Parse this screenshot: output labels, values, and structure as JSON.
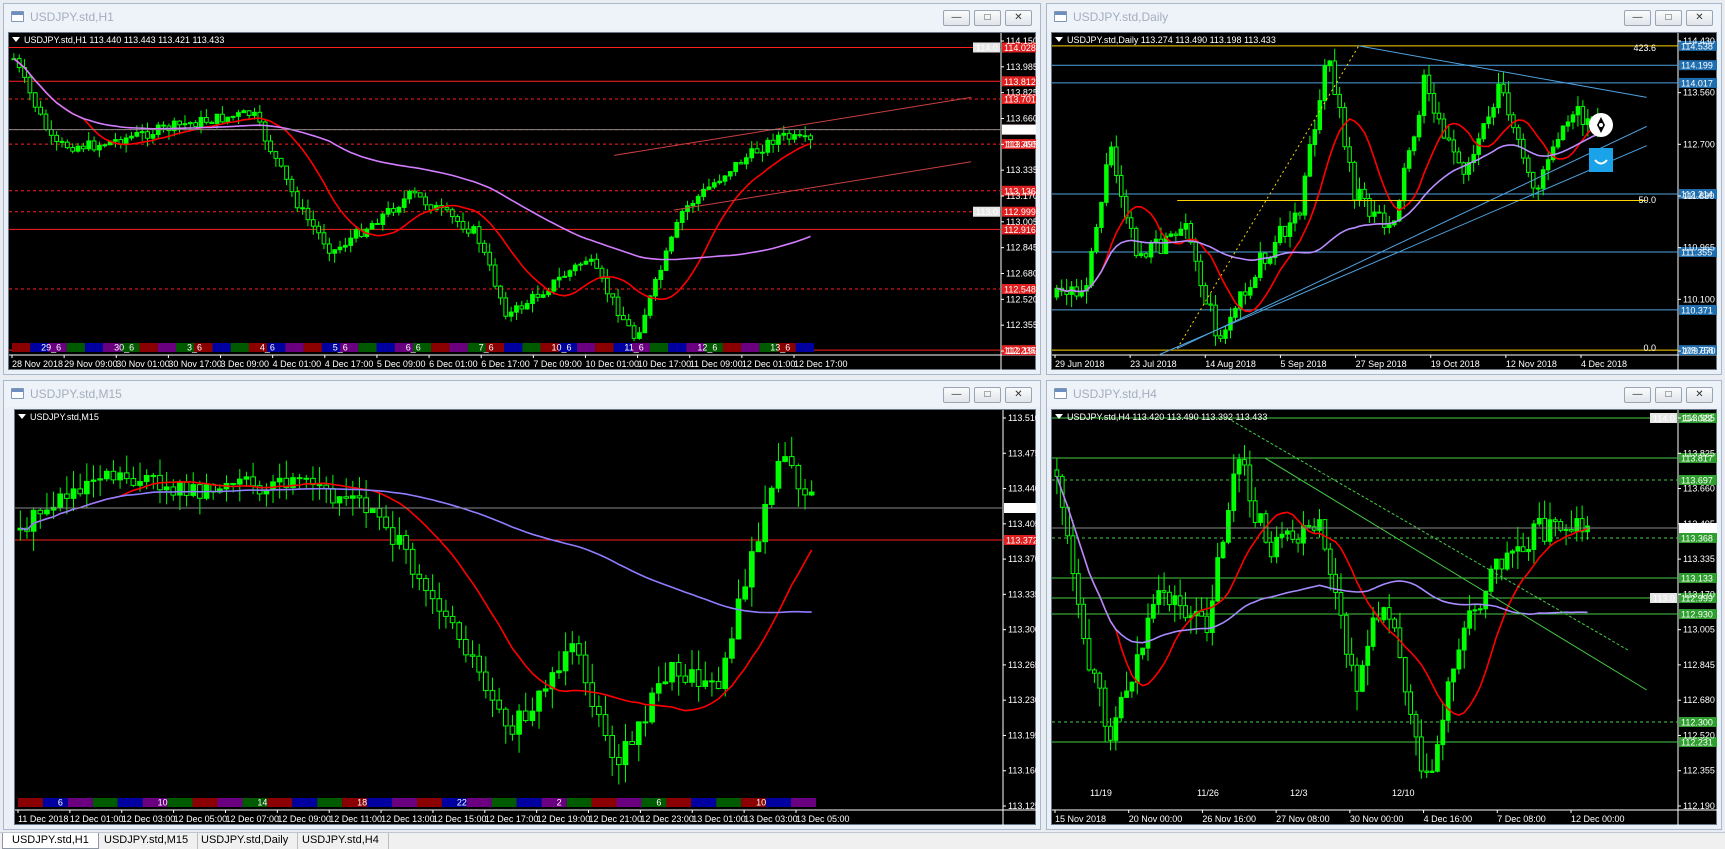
{
  "windows": [
    {
      "id": "h1",
      "title": "USDJPY.std,H1",
      "info": "USDJPY.std,H1  113.440 113.443 113.421 113.433",
      "price_labels": [
        "114.150",
        "113.985",
        "113.825",
        "113.660",
        "113.495",
        "113.335",
        "113.170",
        "113.005",
        "112.845",
        "112.680",
        "112.520",
        "112.355",
        "112.190"
      ],
      "level_labels": [
        "114.028",
        "113.812",
        "113.701",
        "113.450",
        "113.360",
        "113.136",
        "112.999",
        "112.916",
        "112.548",
        "112.235"
      ],
      "current_price": "113.433",
      "markers": [
        "114.0",
        "113.0"
      ],
      "time_labels": [
        "28 Nov 2018",
        "29 Nov 09:00",
        "30 Nov 01:00",
        "30 Nov 17:00",
        "3 Dec 09:00",
        "4 Dec 01:00",
        "4 Dec 17:00",
        "5 Dec 09:00",
        "6 Dec 01:00",
        "6 Dec 17:00",
        "7 Dec 09:00",
        "10 Dec 01:00",
        "10 Dec 17:00",
        "11 Dec 09:00",
        "12 Dec 01:00",
        "12 Dec 17:00"
      ],
      "session_labels": [
        "29_6",
        "30_6",
        "3_6",
        "4_6",
        "5_6",
        "6_6",
        "7_6",
        "10_6",
        "11_6",
        "12_6",
        "13_6"
      ]
    },
    {
      "id": "daily",
      "title": "USDJPY.std,Daily",
      "info": "USDJPY.std,Daily  113.274 113.490 113.198 113.433",
      "price_labels": [
        "114.430",
        "113.560",
        "112.700",
        "111.830",
        "110.965",
        "110.100",
        "109.670"
      ],
      "level_labels": [
        "114.538",
        "114.199",
        "114.017",
        "112.214",
        "111.355",
        "110.371",
        "109.758"
      ],
      "fib_labels": [
        "423.6",
        "50.0",
        "0.0"
      ],
      "time_labels": [
        "29 Jun 2018",
        "23 Jul 2018",
        "14 Aug 2018",
        "5 Sep 2018",
        "27 Sep 2018",
        "19 Oct 2018",
        "12 Nov 2018",
        "4 Dec 2018"
      ]
    },
    {
      "id": "m15",
      "title": "USDJPY.std,M15",
      "info": "USDJPY.std,M15",
      "price_labels": [
        "113.510",
        "113.475",
        "113.440",
        "113.405",
        "113.370",
        "113.335",
        "113.300",
        "113.265",
        "113.230",
        "113.195",
        "113.160",
        "113.125"
      ],
      "current_price": "113.433",
      "level_label": "113.372",
      "time_labels": [
        "11 Dec 2018",
        "12 Dec 01:00",
        "12 Dec 03:00",
        "12 Dec 05:00",
        "12 Dec 07:00",
        "12 Dec 09:00",
        "12 Dec 11:00",
        "12 Dec 13:00",
        "12 Dec 15:00",
        "12 Dec 17:00",
        "12 Dec 19:00",
        "12 Dec 21:00",
        "12 Dec 23:00",
        "13 Dec 01:00",
        "13 Dec 03:00",
        "13 Dec 05:00"
      ],
      "session_labels": [
        "6",
        "10",
        "14",
        "18",
        "22",
        "2",
        "6",
        "10"
      ]
    },
    {
      "id": "h4",
      "title": "USDJPY.std,H4",
      "info": "USDJPY.std,H4  113.420 113.490 113.392 113.433",
      "price_labels": [
        "113.985",
        "113.825",
        "113.660",
        "113.495",
        "113.335",
        "113.170",
        "113.005",
        "112.845",
        "112.680",
        "112.520",
        "112.355",
        "112.190"
      ],
      "level_labels": [
        "114.022",
        "113.817",
        "113.697",
        "113.368",
        "113.133",
        "112.999",
        "112.930",
        "112.300",
        "112.231"
      ],
      "current_price": "113.433",
      "markers": [
        "114.0",
        "113.0"
      ],
      "time_labels": [
        "15 Nov 2018",
        "20 Nov 00:00",
        "26 Nov 16:00",
        "27 Nov 08:00",
        "30 Nov 00:00",
        "4 Dec 16:00",
        "7 Dec 08:00",
        "12 Dec 00:00"
      ],
      "date_marks": [
        "11/19",
        "11/26",
        "12/3",
        "12/10"
      ]
    }
  ],
  "taskbar": [
    "USDJPY.std,H1",
    "USDJPY.std,M15",
    "USDJPY.std,Daily",
    "USDJPY.std,H4"
  ],
  "window_buttons": {
    "minimize": "—",
    "restore": "□",
    "close": "✕"
  },
  "colors": {
    "candle": "#00ff00",
    "ma_fast": "#ff0000",
    "ma_slow": "#cc66ff",
    "level_red": "#ff0000",
    "level_blue": "#4fa3e0",
    "level_green": "#44cc44",
    "fib": "#ffd400"
  }
}
